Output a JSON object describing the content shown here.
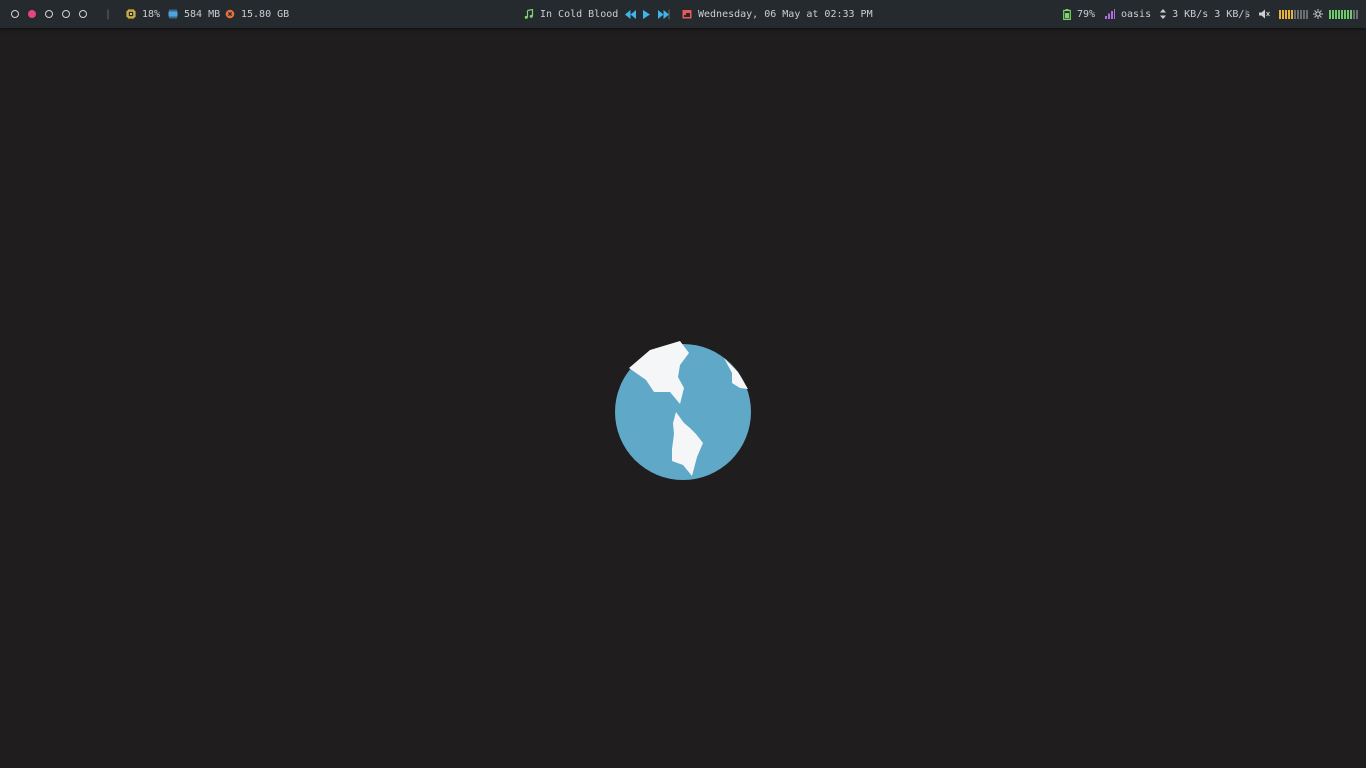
{
  "workspaces": [
    {
      "name": "ws-1",
      "active": false
    },
    {
      "name": "ws-2",
      "active": true
    },
    {
      "name": "ws-3",
      "active": false
    },
    {
      "name": "ws-4",
      "active": false
    },
    {
      "name": "ws-5",
      "active": false
    }
  ],
  "system": {
    "cpu": "18%",
    "memory": "584 MB",
    "disk": "15.80 GB"
  },
  "music": {
    "track": "In Cold Blood"
  },
  "datetime": "Wednesday, 06 May at 02:33 PM",
  "status": {
    "battery": "79%",
    "network_name": "oasis",
    "network_speed": "3 KB/s 3 KB/s",
    "volume_level": 0.5,
    "brightness_level": 0.8
  },
  "colors": {
    "bar_bg": "#252a2e",
    "desktop_bg": "#201d1e",
    "accent_pink": "#e8457a",
    "cpu_icon": "#e8c547",
    "mem_icon": "#4fa3e0",
    "disk_icon": "#e8723a",
    "music_icon": "#7ed36b",
    "media_controls": "#3fb4e8",
    "calendar_icon": "#e85a5a",
    "battery_icon": "#7ed36b",
    "network_icon": "#b06de0",
    "volume_meter": "#e8b23a",
    "brightness_meter": "#6fc86a",
    "globe_ocean": "#5fa8c8",
    "globe_land": "#f5f6f7"
  }
}
